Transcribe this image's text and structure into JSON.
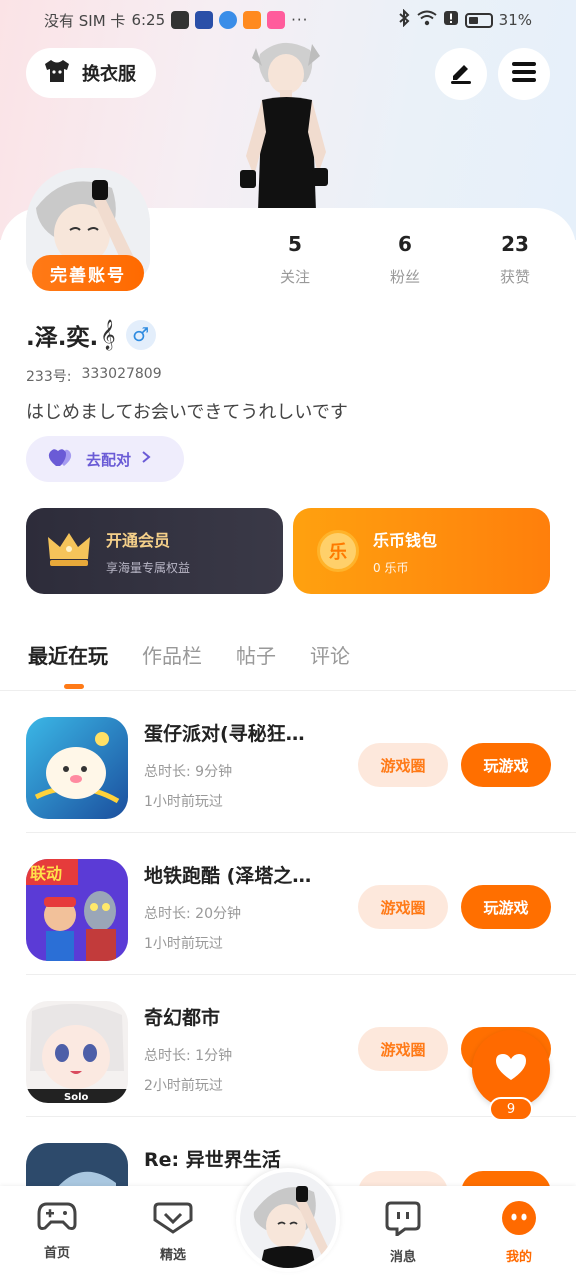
{
  "status_bar": {
    "carrier": "没有 SIM 卡",
    "time": "6:25",
    "dots": "···",
    "battery": "31%"
  },
  "header": {
    "outfit_label": "换衣服",
    "edit_icon": "pencil-icon",
    "menu_icon": "menu-icon"
  },
  "profile": {
    "badge": "完善账号",
    "stats": [
      {
        "num": "5",
        "label": "关注"
      },
      {
        "num": "6",
        "label": "粉丝"
      },
      {
        "num": "23",
        "label": "获赞"
      }
    ],
    "username": ".泽.奕.",
    "gender_symbol": "♂",
    "id_label": "233号:",
    "id_value": "333027809",
    "bio": "はじめましてお会いできてうれしいです",
    "match_label": "去配对"
  },
  "cards": {
    "vip_title": "开通会员",
    "vip_sub": "享海量专属权益",
    "wallet_title": "乐币钱包",
    "wallet_sub": "0 乐币",
    "coin_glyph": "乐"
  },
  "tabs": [
    "最近在玩",
    "作品栏",
    "帖子",
    "评论"
  ],
  "games": [
    {
      "name": "蛋仔派对(寻秘狂…",
      "duration": "总时长: 9分钟",
      "last": "1小时前玩过",
      "circle_btn": "游戏圈",
      "play_btn": "玩游戏"
    },
    {
      "name": "地铁跑酷 (泽塔之…",
      "duration": "总时长: 20分钟",
      "last": "1小时前玩过",
      "circle_btn": "游戏圈",
      "play_btn": "玩游戏"
    },
    {
      "name": "奇幻都市",
      "duration": "总时长: 1分钟",
      "last": "2小时前玩过",
      "circle_btn": "游戏圈",
      "play_btn": "玩游戏"
    },
    {
      "name": "Re: 异世界生活",
      "duration": "",
      "last": "",
      "circle_btn": "",
      "play_btn": ""
    }
  ],
  "fab": {
    "count": "9"
  },
  "bottom_nav": [
    {
      "label": "首页",
      "icon": "gamepad-icon"
    },
    {
      "label": "精选",
      "icon": "heart-box-icon"
    },
    {
      "label": "消息",
      "icon": "chat-icon"
    },
    {
      "label": "我的",
      "icon": "face-icon"
    }
  ],
  "colors": {
    "accent": "#ff6a00",
    "vip_bg": "#2d2c3a",
    "match_bg": "#efedfc",
    "match_text": "#6a5bd6"
  }
}
